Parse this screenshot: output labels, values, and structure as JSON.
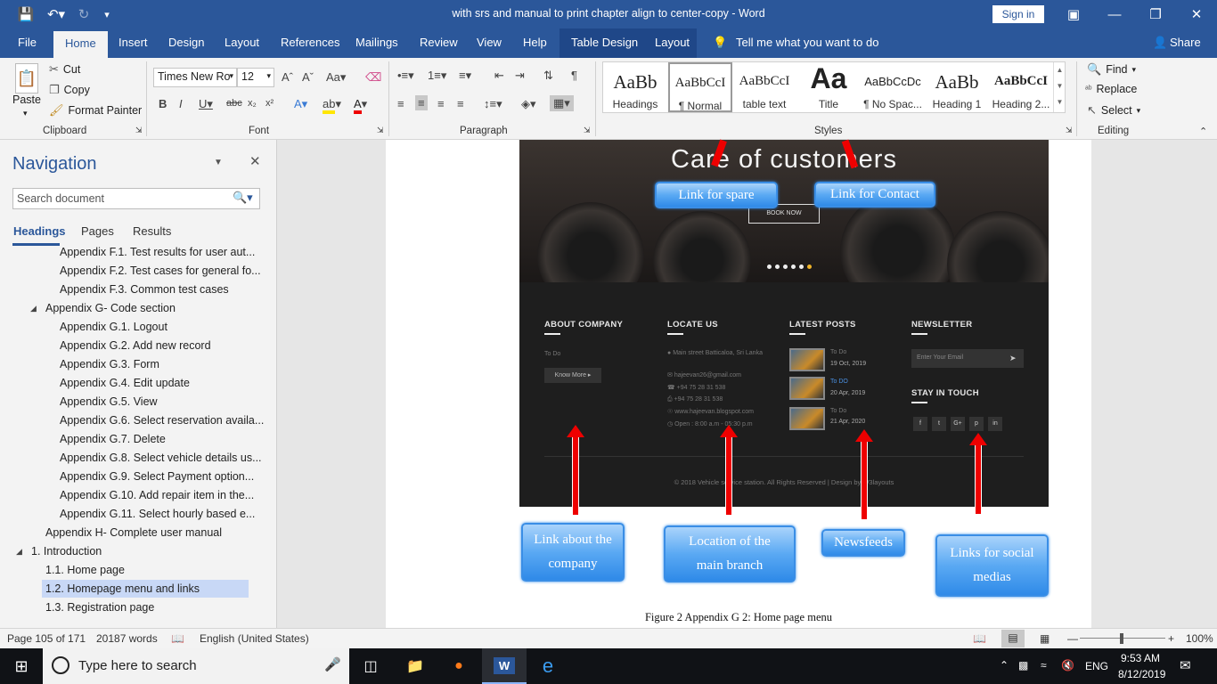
{
  "titlebar": {
    "doc_title": "with srs and manual to print chapter align to center-copy  -  Word",
    "sign_in": "Sign in"
  },
  "tabs": [
    "File",
    "Home",
    "Insert",
    "Design",
    "Layout",
    "References",
    "Mailings",
    "Review",
    "View",
    "Help",
    "Table Design",
    "Layout"
  ],
  "tell_me": "Tell me what you want to do",
  "share": "Share",
  "clipboard": {
    "paste": "Paste",
    "cut": "Cut",
    "copy": "Copy",
    "format_painter": "Format Painter",
    "label": "Clipboard"
  },
  "font": {
    "name": "Times New Ro",
    "size": "12",
    "label": "Font"
  },
  "paragraph": {
    "label": "Paragraph"
  },
  "styles": {
    "label": "Styles",
    "items": [
      {
        "preview": "AaBb",
        "name": "Headings"
      },
      {
        "preview": "AaBbCcI",
        "name": "¶ Normal"
      },
      {
        "preview": "AaBbCcI",
        "name": "table text"
      },
      {
        "preview": "Aa",
        "name": "Title"
      },
      {
        "preview": "AaBbCcDc",
        "name": "¶ No Spac..."
      },
      {
        "preview": "AaBb",
        "name": "Heading 1"
      },
      {
        "preview": "AaBbCcI",
        "name": "Heading 2..."
      }
    ]
  },
  "editing": {
    "find": "Find",
    "replace": "Replace",
    "select": "Select",
    "label": "Editing"
  },
  "nav": {
    "title": "Navigation",
    "search_placeholder": "Search document",
    "tabs": [
      "Headings",
      "Pages",
      "Results"
    ],
    "items": [
      "Appendix F.1. Test results for user aut...",
      "Appendix F.2. Test cases for general fo...",
      "Appendix F.3. Common test cases",
      "Appendix G- Code section",
      "Appendix G.1. Logout",
      "Appendix G.2. Add new record",
      "Appendix G.3. Form",
      "Appendix G.4. Edit update",
      "Appendix G.5. View",
      "Appendix G.6. Select reservation availa...",
      "Appendix G.7. Delete",
      "Appendix G.8. Select vehicle details us...",
      "Appendix G.9. Select Payment option...",
      "Appendix G.10. Add repair item in the...",
      "Appendix G.11. Select hourly based e...",
      "Appendix H- Complete user manual",
      "1. Introduction",
      "1.1.  Home page",
      "1.2.  Homepage menu and links",
      "1.3.  Registration page"
    ]
  },
  "figure": {
    "hero_title": "Care of customers",
    "book_now": "BOOK NOW",
    "callout_spare": "Link for spare",
    "callout_contact": "Link for Contact",
    "about_head": "ABOUT COMPANY",
    "about_text": "To Do",
    "know_more": "Know More ▸",
    "locate_head": "LOCATE US",
    "locate_lines": [
      "Main street      Batticaloa, Sri Lanka",
      "hajeevan26@gmail.com",
      "+94 75 28 31 538",
      "+94 75 28 31 538",
      "www.hajeevan.blogspot.com",
      "Open : 8:00 a.m - 05:30 p.m"
    ],
    "posts_head": "LATEST POSTS",
    "posts": [
      {
        "title": "To Do",
        "date": "19 Oct, 2019"
      },
      {
        "title": "To DO",
        "date": "20 Apr, 2019"
      },
      {
        "title": "To Do",
        "date": "21 Apr, 2020"
      }
    ],
    "newsletter_head": "NEWSLETTER",
    "email_placeholder": "Enter Your Email",
    "stay_head": "STAY IN TOUCH",
    "copyright": "© 2018 Vehicle service station. All Rights Reserved | Design by W3layouts",
    "callout_about": "Link about the company",
    "callout_location": "Location of the main branch",
    "callout_news": "Newsfeeds",
    "callout_social": "Links for social medias",
    "caption": "Figure 2 Appendix G 2: Home page menu"
  },
  "status": {
    "page": "Page 105 of 171",
    "words": "20187 words",
    "language": "English (United States)",
    "zoom": "100%"
  },
  "taskbar": {
    "search": "Type here to search",
    "lang": "ENG",
    "time": "9:53 AM",
    "date": "8/12/2019"
  }
}
